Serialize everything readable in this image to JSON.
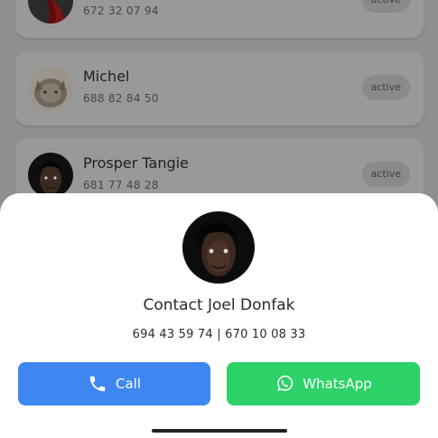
{
  "contacts": [
    {
      "name": "",
      "phone": "672 32 07 94",
      "status": "active",
      "avatar": "contact-photo-red"
    },
    {
      "name": "Michel",
      "phone": "688 82 84 50",
      "status": "active",
      "avatar": "cat-photo"
    },
    {
      "name": "Prosper Tangie",
      "phone": "681 77 48 28",
      "status": "active",
      "avatar": "person-photo"
    }
  ],
  "sheet": {
    "title": "Contact Joel Donfak",
    "phones": "694 43 59 74 | 670 10 08 33",
    "avatar": "person-photo",
    "call_label": "Call",
    "whatsapp_label": "WhatsApp"
  },
  "colors": {
    "call": "#3f87f0",
    "whatsapp": "#2dd268",
    "overlay": "#8f8f8f"
  }
}
